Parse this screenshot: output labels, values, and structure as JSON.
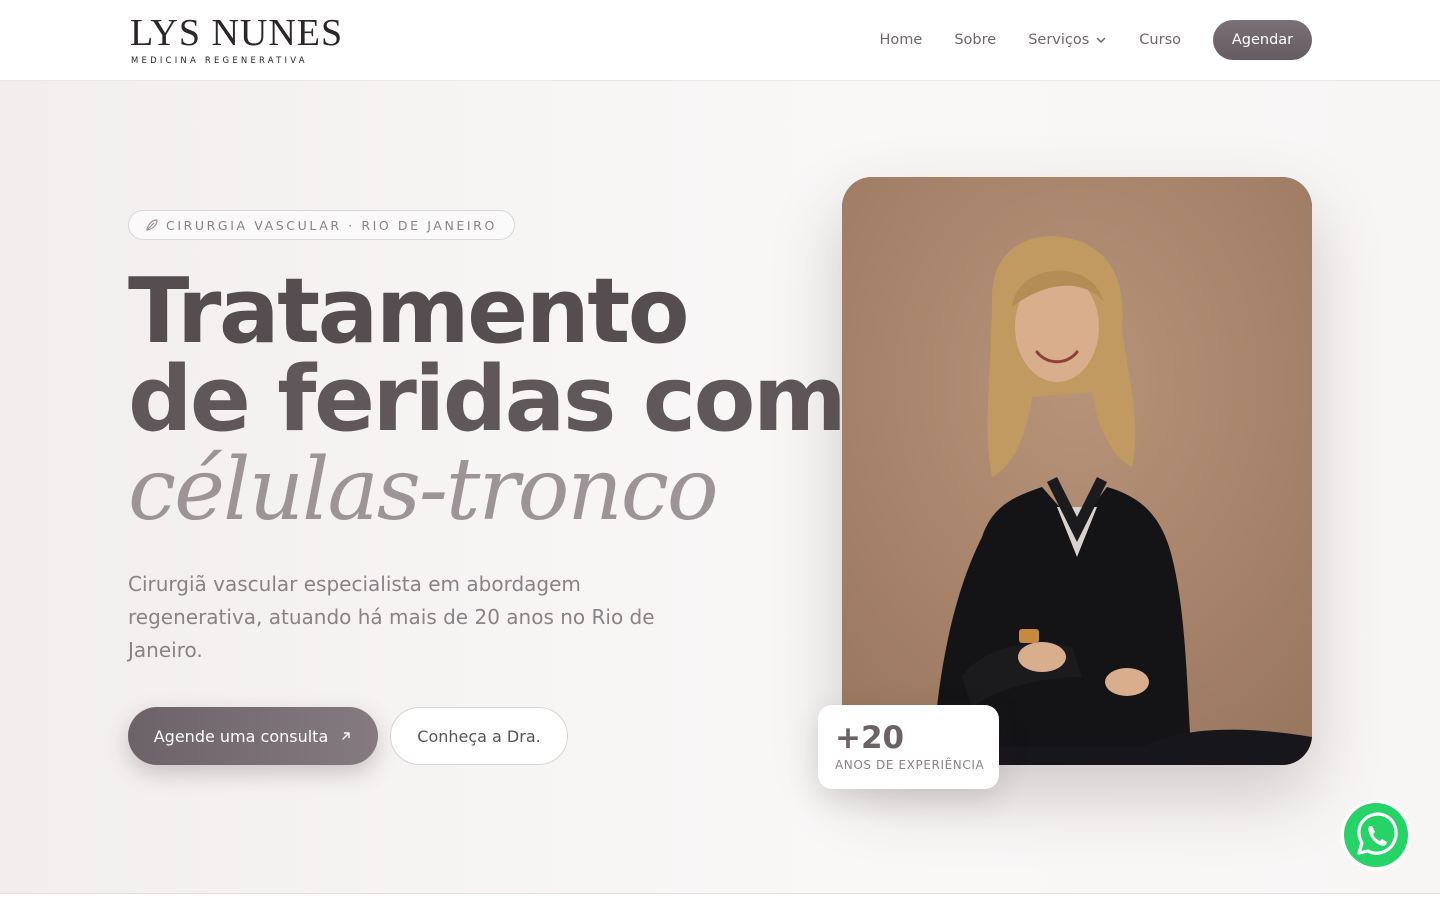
{
  "header": {
    "logo": {
      "main": "LYS NUNES",
      "sub": "MEDICINA REGENERATIVA"
    },
    "nav": [
      {
        "label": "Home"
      },
      {
        "label": "Sobre"
      },
      {
        "label": "Serviços",
        "has_dropdown": true
      },
      {
        "label": "Curso"
      }
    ],
    "cta_label": "Agendar"
  },
  "hero": {
    "badge": "CIRURGIA VASCULAR · RIO DE JANEIRO",
    "title_line1": "Tratamento",
    "title_line2": "de feridas com",
    "title_italic": "células-tronco",
    "description": "Cirurgiã vascular especialista em abordagem regenerativa, atuando há mais de 20 anos no Rio de Janeiro.",
    "primary_button": "Agende uma consulta",
    "secondary_button": "Conheça a Dra.",
    "experience": {
      "number": "+20",
      "label": "ANOS DE EXPERIÊNCIA"
    }
  },
  "icons": {
    "badge": "leaf-icon",
    "nav_dropdown": "chevron-down-icon",
    "primary_arrow": "arrow-up-right-icon",
    "floating": "whatsapp-icon"
  },
  "colors": {
    "brand": "#6b6267",
    "accent_light": "#9d9497",
    "whatsapp": "#25d366",
    "background": "#f8f6f5"
  }
}
